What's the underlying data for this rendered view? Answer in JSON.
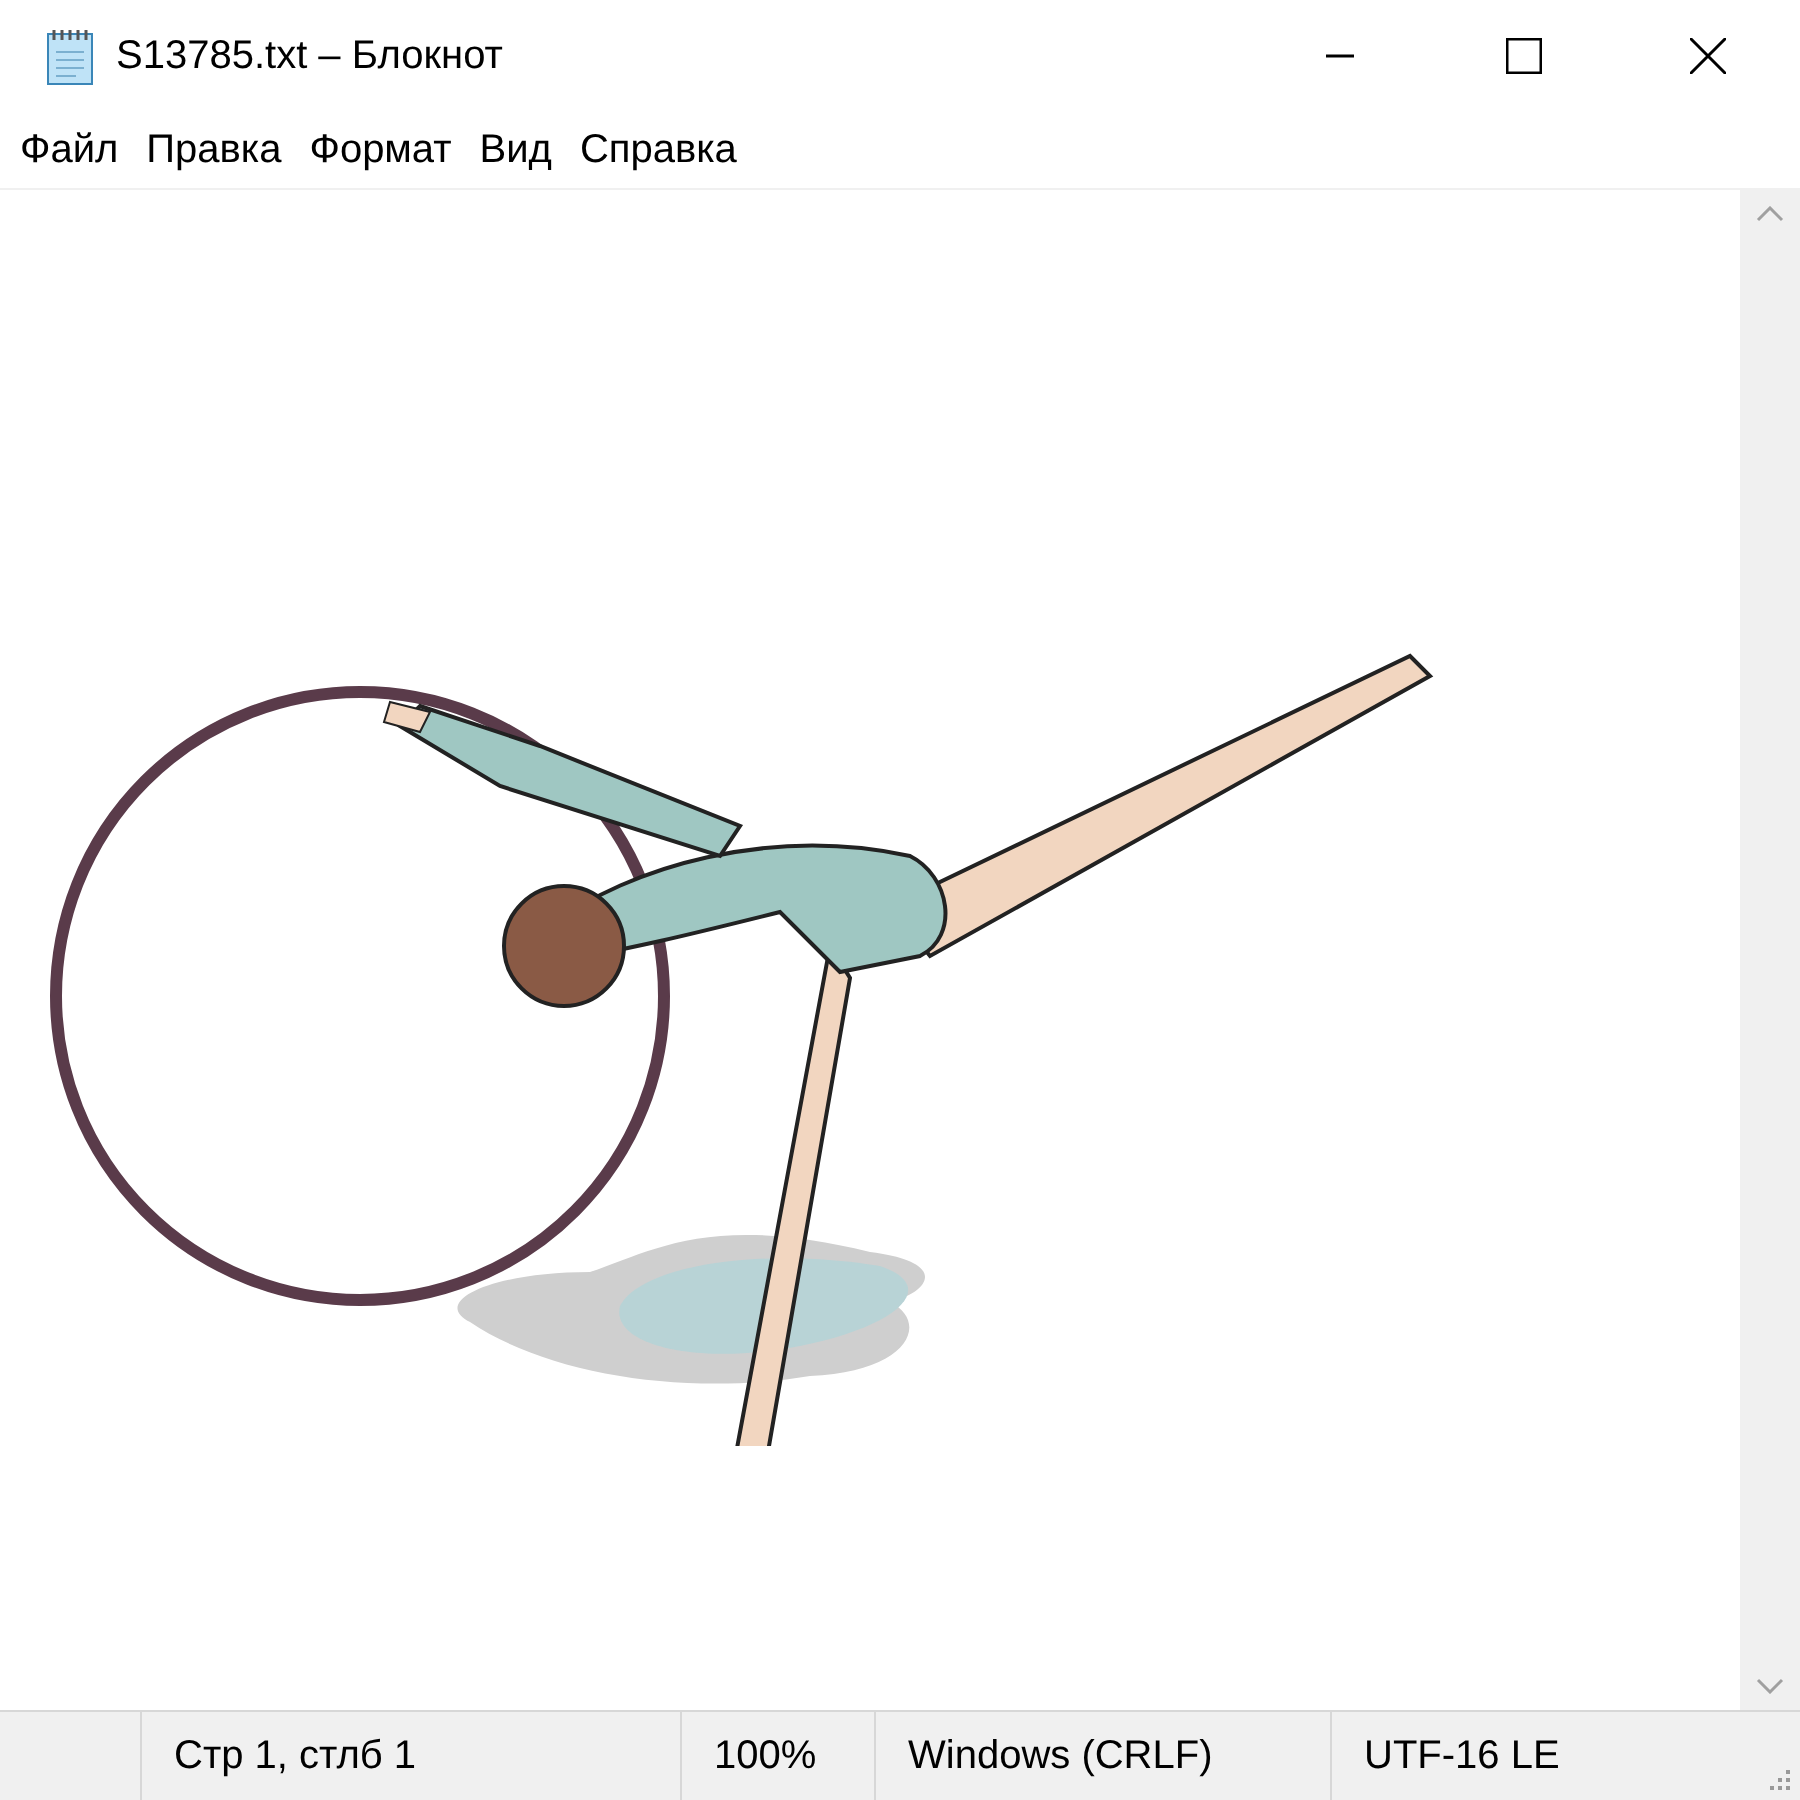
{
  "window": {
    "title": "S13785.txt – Блокнот"
  },
  "menu": [
    "Файл",
    "Правка",
    "Формат",
    "Вид",
    "Справка"
  ],
  "status_bar": [
    "Стр 1, стлб 1",
    "100%",
    "Windows (CRLF)",
    "UTF-16 LE"
  ]
}
